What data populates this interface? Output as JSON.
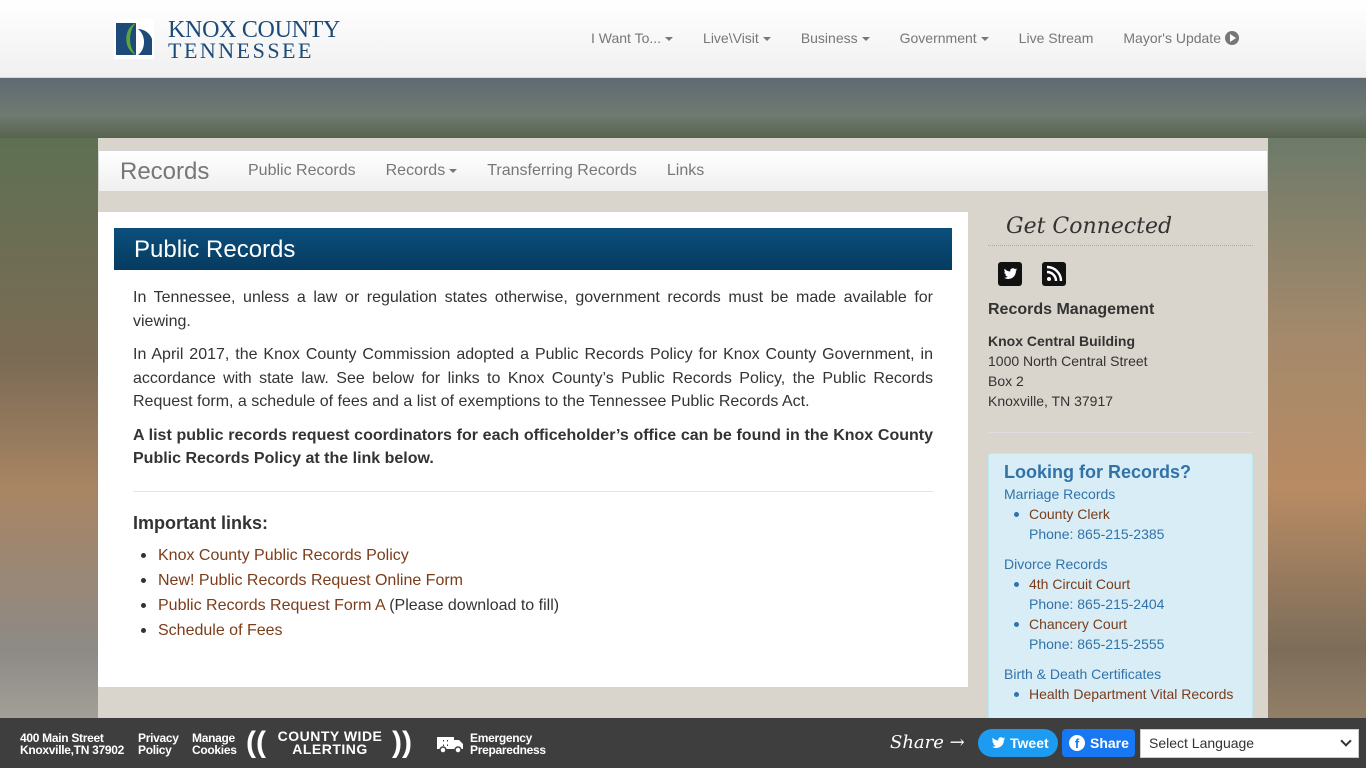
{
  "header": {
    "logo_line1": "KNOX COUNTY",
    "logo_line2": "TENNESSEE",
    "nav": [
      {
        "label": "I Want To...",
        "has_caret": true
      },
      {
        "label": "Live\\Visit",
        "has_caret": true
      },
      {
        "label": "Business",
        "has_caret": true
      },
      {
        "label": "Government",
        "has_caret": true
      },
      {
        "label": "Live Stream",
        "has_caret": false
      },
      {
        "label": "Mayor's Update",
        "has_caret": false
      }
    ]
  },
  "subnav": {
    "brand": "Records",
    "items": [
      "Public Records",
      "Records",
      "Transferring Records",
      "Links"
    ]
  },
  "main": {
    "title": "Public Records",
    "para1": "In Tennessee, unless a law or regulation states otherwise, government records must be made available for viewing.",
    "para2": "In April 2017, the Knox County Commission adopted a Public Records Policy for Knox County Government, in accordance with state law. See below for links to Knox County’s Public Records Policy, the Public Records Request form, a schedule of fees and a list of exemptions to the Tennessee Public Records Act.",
    "para3": "A list public records request coordinators for each officeholder’s office can be found in the Knox County Public Records Policy at the link below.",
    "links_heading": "Important links:",
    "links": [
      {
        "label": "Knox County Public Records Policy",
        "note": ""
      },
      {
        "label": "New! Public Records Request Online Form",
        "note": ""
      },
      {
        "label": "Public Records Request Form A",
        "note": " (Please download to fill)"
      },
      {
        "label": "Schedule of Fees",
        "note": ""
      }
    ]
  },
  "sidebar": {
    "connected_title": "Get Connected",
    "section_title": "Records Management",
    "building": "Knox Central Building",
    "street": "1000 North Central Street",
    "box": "Box 2",
    "city": "Knoxville, TN 37917",
    "looking_title": "Looking for Records?",
    "categories": [
      {
        "name": "Marriage Records",
        "entries": [
          {
            "label": "County Clerk",
            "phone": "Phone: 865-215-2385"
          }
        ]
      },
      {
        "name": "Divorce Records",
        "entries": [
          {
            "label": "4th Circuit Court",
            "phone": "Phone: 865-215-2404"
          },
          {
            "label": "Chancery Court",
            "phone": "Phone: 865-215-2555"
          }
        ]
      },
      {
        "name": "Birth & Death Certificates",
        "entries": [
          {
            "label": "Health Department Vital Records",
            "phone": ""
          }
        ]
      }
    ]
  },
  "footer": {
    "address_line1": "400 Main Street",
    "address_line2": "Knoxville,TN 37902",
    "privacy_line1": "Privacy",
    "privacy_line2": "Policy",
    "cookies_line1": "Manage",
    "cookies_line2": "Cookies",
    "alert_line1": "COUNTY WIDE",
    "alert_line2": "ALERTING",
    "emergency_line1": "Emergency",
    "emergency_line2": "Preparedness",
    "share_label": "Share",
    "tweet_label": "Tweet",
    "fb_label": "Share",
    "language_select": "Select Language"
  },
  "colors": {
    "title_bar": "#063b60",
    "link": "#7b3c1a",
    "info_blue": "#3173a8",
    "footer_bg": "#3e3e3e"
  }
}
